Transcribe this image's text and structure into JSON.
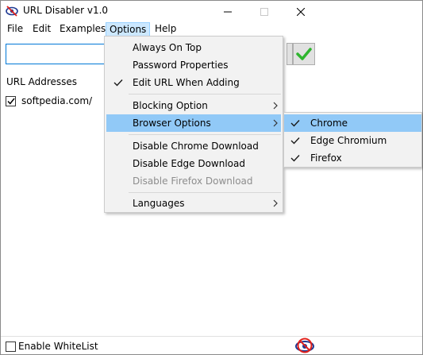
{
  "window": {
    "title": "URL Disabler v1.0"
  },
  "menubar": {
    "file": "File",
    "edit": "Edit",
    "examples": "Examples",
    "options": "Options",
    "help": "Help"
  },
  "toolbar": {
    "url_value": ""
  },
  "list": {
    "header": "URL Addresses",
    "rows": [
      {
        "label": "softpedia.com/",
        "checked": true
      }
    ]
  },
  "statusbar": {
    "whitelist_label": "Enable WhiteList",
    "whitelist_checked": false
  },
  "options_menu": {
    "items": [
      {
        "label": "Always On Top",
        "checked": false
      },
      {
        "label": "Password Properties",
        "checked": false
      },
      {
        "label": "Edit URL When Adding",
        "checked": true
      },
      {
        "label": "Blocking Option",
        "submenu": true
      },
      {
        "label": "Browser Options",
        "submenu": true,
        "highlighted": true
      },
      {
        "label": "Disable Chrome Download"
      },
      {
        "label": "Disable Edge Download"
      },
      {
        "label": "Disable Firefox Download",
        "disabled": true
      },
      {
        "label": "Languages",
        "submenu": true
      }
    ]
  },
  "browser_submenu": {
    "items": [
      {
        "label": "Chrome",
        "checked": true,
        "highlighted": true
      },
      {
        "label": "Edge Chromium",
        "checked": true
      },
      {
        "label": "Firefox",
        "checked": true
      }
    ]
  },
  "colors": {
    "menu_highlight": "#91c9f7",
    "menubar_active": "#cce8ff",
    "accent": "#0078d7",
    "confirm_green": "#2fb52f",
    "logo_red": "#e0201b"
  }
}
